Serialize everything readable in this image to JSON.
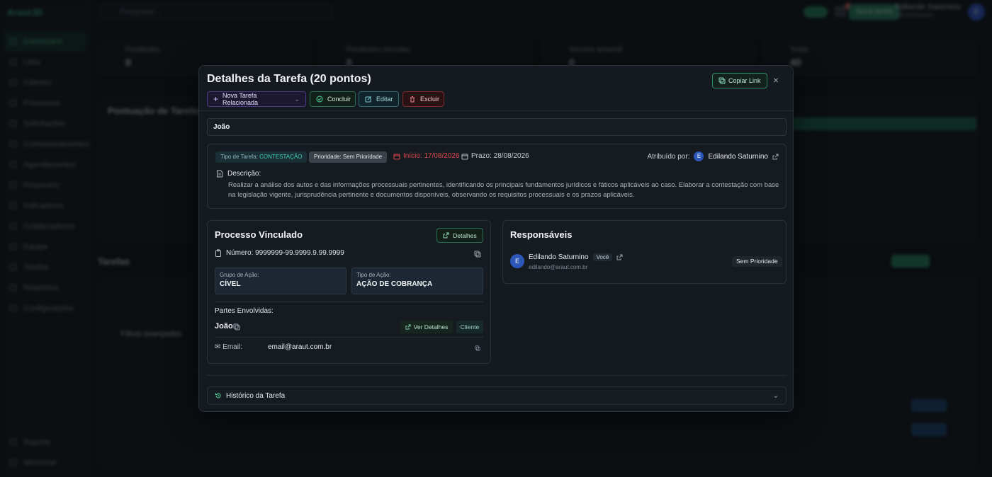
{
  "background": {
    "logo": "ArautJD",
    "search_placeholder": "Pesquisar...",
    "sidebar": [
      "Dashboard",
      "Lista",
      "Clientes",
      "Processos",
      "Solicitações",
      "Comissionamentos",
      "Agendamentos",
      "Financeiro",
      "Indicadores",
      "Colaboradores",
      "Equipe",
      "Tarefas",
      "Relatórios",
      "Configurações"
    ],
    "sidebar_bottom": [
      "Suporte",
      "Minimizar"
    ],
    "user_name": "Edilando Saturnino",
    "user_role": "Administrador",
    "new_button": "Nova tarefa",
    "notif_count": "1",
    "cards": [
      {
        "label": "Pendentes",
        "value": "0"
      },
      {
        "label": "Pendentes vencidas",
        "value": "0"
      },
      {
        "label": "Vencem amanhã",
        "value": "0"
      },
      {
        "label": "Totais",
        "value": "40"
      }
    ],
    "chart_title": "Pontuação de Tarefas",
    "tasks_title": "Tarefas",
    "filters_label": "Filtros avançados"
  },
  "modal": {
    "title": "Detalhes da Tarefa (20 pontos)",
    "copy_link": "Copiar Link",
    "close": "×",
    "buttons": {
      "related": "Nova Tarefa Relacionada",
      "done": "Concluir",
      "edit": "Editar",
      "delete": "Excluir"
    },
    "client_name": "João",
    "info": {
      "type_label": "Tipo de Tarefa:",
      "type_value": "CONTESTAÇÃO",
      "priority": "Prioridade: Sem Prioridade",
      "start": "Início: 17/08/2026",
      "deadline": "Prazo: 28/08/2026",
      "assigned_by_label": "Atribuído por:",
      "assigned_by_initial": "E",
      "assigned_by_name": "Edilando Saturnino",
      "description_label": "Descrição:",
      "description": "Realizar a análise dos autos e das informações processuais pertinentes, identificando os principais fundamentos jurídicos e fáticos aplicáveis ao caso. Elaborar a contestação com base na legislação vigente, jurisprudência pertinente e documentos disponíveis, observando os requisitos processuais e os prazos aplicáveis."
    },
    "process": {
      "title": "Processo Vinculado",
      "details_button": "Detalhes",
      "number": "Número: 9999999-99.9999.9.99.9999",
      "group_label": "Grupo de Ação:",
      "group_value": "CÍVEL",
      "action_label": "Tipo de Ação:",
      "action_value": "AÇÃO DE COBRANÇA",
      "parties_label": "Partes Envolvidas:",
      "party_name": "João",
      "view_details": "Ver Detalhes",
      "party_role": "Cliente",
      "email_label": "Email:",
      "email_value": "email@araut.com.br"
    },
    "responsibles": {
      "title": "Responsáveis",
      "initial": "E",
      "name": "Edilando Saturnino",
      "you": "Você",
      "email": "edilando@araut.com.br",
      "priority": "Sem Prioridade"
    },
    "history": "Histórico da Tarefa"
  },
  "colors": {
    "accent": "#2a8a66",
    "danger": "#e0494f",
    "avatar": "#2c56b8"
  }
}
